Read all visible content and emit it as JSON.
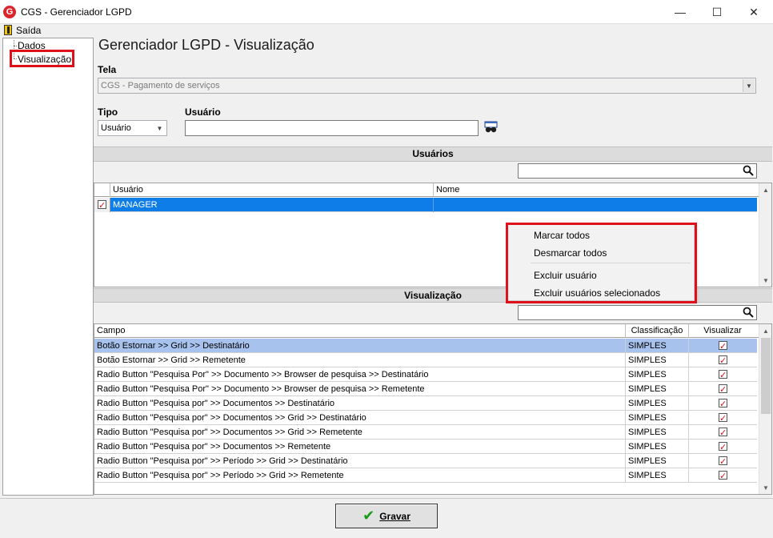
{
  "window": {
    "logo": "G",
    "title": "CGS - Gerenciador LGPD",
    "minimize": "—",
    "maximize": "☐",
    "close": "✕"
  },
  "menu": {
    "exit_label": "Saída"
  },
  "tree": {
    "items": [
      {
        "label": "Dados"
      },
      {
        "label": "Visualização"
      }
    ]
  },
  "main": {
    "page_title": "Gerenciador LGPD - Visualização",
    "tela_label": "Tela",
    "tela_value": "CGS - Pagamento de serviços",
    "tipo_label": "Tipo",
    "tipo_value": "Usuário",
    "usuario_label": "Usuário",
    "usuario_value": ""
  },
  "users_section": {
    "header": "Usuários",
    "search_value": "",
    "columns": [
      "Usuário",
      "Nome"
    ],
    "rows": [
      {
        "usuario": "MANAGER",
        "nome": "",
        "checked": true
      }
    ]
  },
  "context_menu": {
    "items": [
      "Marcar todos",
      "Desmarcar todos",
      "Excluir usuário",
      "Excluir usuários selecionados"
    ]
  },
  "vis_section": {
    "header": "Visualização",
    "search_value": "",
    "columns": [
      "Campo",
      "Classificação",
      "Visualizar"
    ],
    "rows": [
      {
        "campo": "Botão Estornar >> Grid >> Destinatário",
        "classificacao": "SIMPLES",
        "visualizar": true
      },
      {
        "campo": "Botão Estornar >> Grid >> Remetente",
        "classificacao": "SIMPLES",
        "visualizar": true
      },
      {
        "campo": "Radio Button \"Pesquisa Por\" >> Documento >> Browser de pesquisa >> Destinatário",
        "classificacao": "SIMPLES",
        "visualizar": true
      },
      {
        "campo": "Radio Button \"Pesquisa Por\" >> Documento >> Browser de pesquisa >> Remetente",
        "classificacao": "SIMPLES",
        "visualizar": true
      },
      {
        "campo": "Radio Button \"Pesquisa por\" >> Documentos >> Destinatário",
        "classificacao": "SIMPLES",
        "visualizar": true
      },
      {
        "campo": "Radio Button \"Pesquisa por\" >> Documentos >> Grid >> Destinatário",
        "classificacao": "SIMPLES",
        "visualizar": true
      },
      {
        "campo": "Radio Button \"Pesquisa por\" >> Documentos >> Grid >> Remetente",
        "classificacao": "SIMPLES",
        "visualizar": true
      },
      {
        "campo": "Radio Button \"Pesquisa por\" >> Documentos >> Remetente",
        "classificacao": "SIMPLES",
        "visualizar": true
      },
      {
        "campo": "Radio Button \"Pesquisa por\" >> Período >> Grid >> Destinatário",
        "classificacao": "SIMPLES",
        "visualizar": true
      },
      {
        "campo": "Radio Button \"Pesquisa por\" >> Período >> Grid >> Remetente",
        "classificacao": "SIMPLES",
        "visualizar": true
      }
    ]
  },
  "footer": {
    "save_label": "Gravar"
  },
  "colors": {
    "selection_blue": "#0f7de8",
    "selection_light": "#a8c2ee",
    "highlight_red": "#e0101a",
    "check_green": "#1a9a1a"
  }
}
